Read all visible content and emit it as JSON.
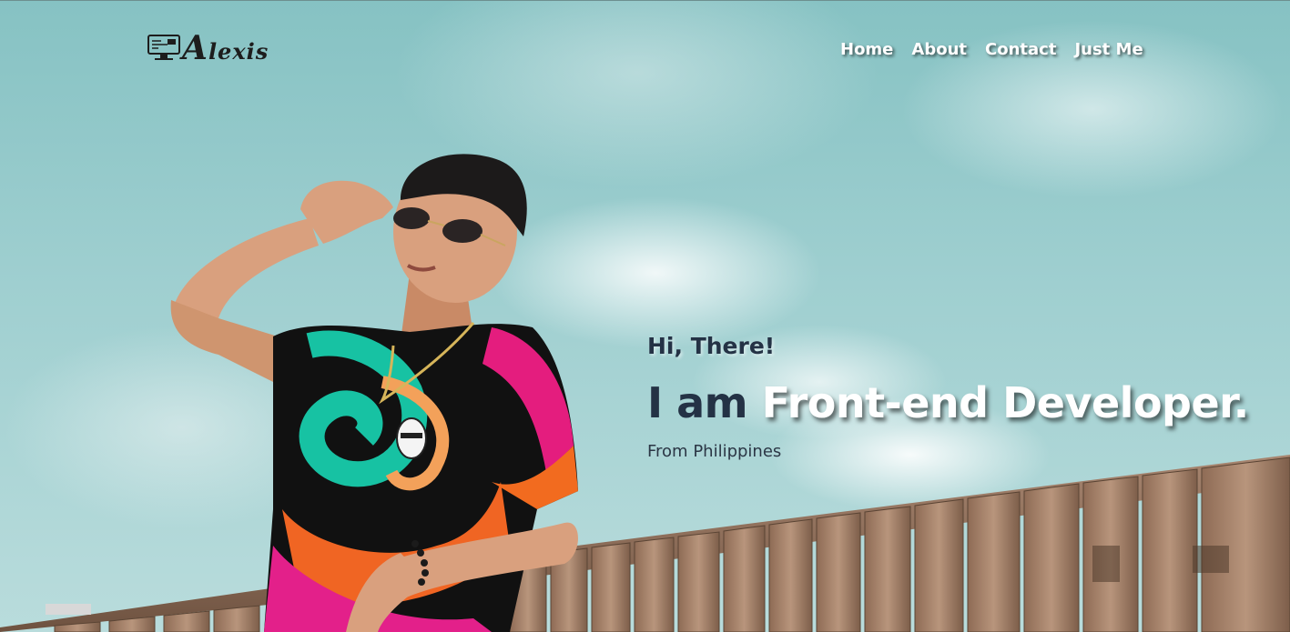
{
  "brand": {
    "logo_icon": "computer-monitor-icon",
    "logo_initial": "A",
    "logo_rest": "lexis"
  },
  "nav": {
    "items": [
      {
        "label": "Home"
      },
      {
        "label": "About"
      },
      {
        "label": "Contact"
      },
      {
        "label": "Just Me"
      }
    ]
  },
  "hero": {
    "greeting": "Hi, There!",
    "headline_dark": "I am ",
    "headline_light": "Front-end Developer.",
    "subline": "From Philippines"
  },
  "colors": {
    "sky": "#8fc6c6",
    "heading_dark": "#243245",
    "heading_light": "#ffffff",
    "fence_wood": "#9a7a62"
  }
}
